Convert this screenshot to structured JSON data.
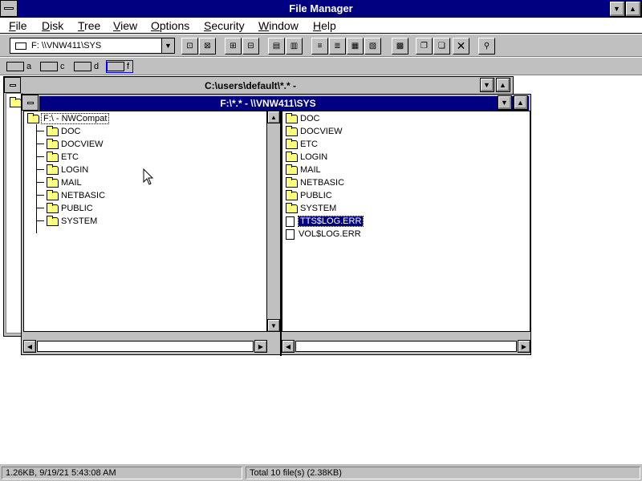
{
  "app": {
    "title": "File Manager"
  },
  "menus": [
    {
      "first": "F",
      "rest": "ile"
    },
    {
      "first": "D",
      "rest": "isk"
    },
    {
      "first": "T",
      "rest": "ree"
    },
    {
      "first": "V",
      "rest": "iew"
    },
    {
      "first": "O",
      "rest": "ptions"
    },
    {
      "first": "S",
      "rest": "ecurity"
    },
    {
      "first": "W",
      "rest": "indow"
    },
    {
      "first": "H",
      "rest": "elp"
    }
  ],
  "toolbar": {
    "drive_value": "F: \\\\VNW411\\SYS",
    "buttons": [
      "connect-network-drive",
      "disconnect-network-drive",
      "share-as",
      "stop-sharing",
      "view-tree-and-directory",
      "view-directory-only",
      "sort-by-name",
      "sort-by-type",
      "sort-by-size",
      "sort-by-date",
      "view-details",
      "copy",
      "move",
      "delete",
      "properties"
    ]
  },
  "drives": [
    {
      "letter": "a",
      "icon": "floppy-drive-icon"
    },
    {
      "letter": "c",
      "icon": "hard-drive-icon"
    },
    {
      "letter": "d",
      "icon": "cdrom-drive-icon"
    },
    {
      "letter": "f",
      "icon": "network-drive-icon",
      "selected": true
    }
  ],
  "back_window": {
    "title": "C:\\users\\default\\*.* -"
  },
  "front_window": {
    "title": "F:\\*.* - \\\\VNW411\\SYS",
    "tree": {
      "root": "F:\\ - NWCompat",
      "folders": [
        "DOC",
        "DOCVIEW",
        "ETC",
        "LOGIN",
        "MAIL",
        "NETBASIC",
        "PUBLIC",
        "SYSTEM"
      ]
    },
    "files": {
      "folders": [
        "DOC",
        "DOCVIEW",
        "ETC",
        "LOGIN",
        "MAIL",
        "NETBASIC",
        "PUBLIC",
        "SYSTEM"
      ],
      "documents": [
        {
          "name": "TTS$LOG.ERR",
          "selected": true
        },
        {
          "name": "VOL$LOG.ERR",
          "selected": false
        }
      ]
    }
  },
  "status": {
    "left": "1.26KB, 9/19/21 5:43:08 AM",
    "right": "Total 10 file(s) (2.38KB)"
  }
}
